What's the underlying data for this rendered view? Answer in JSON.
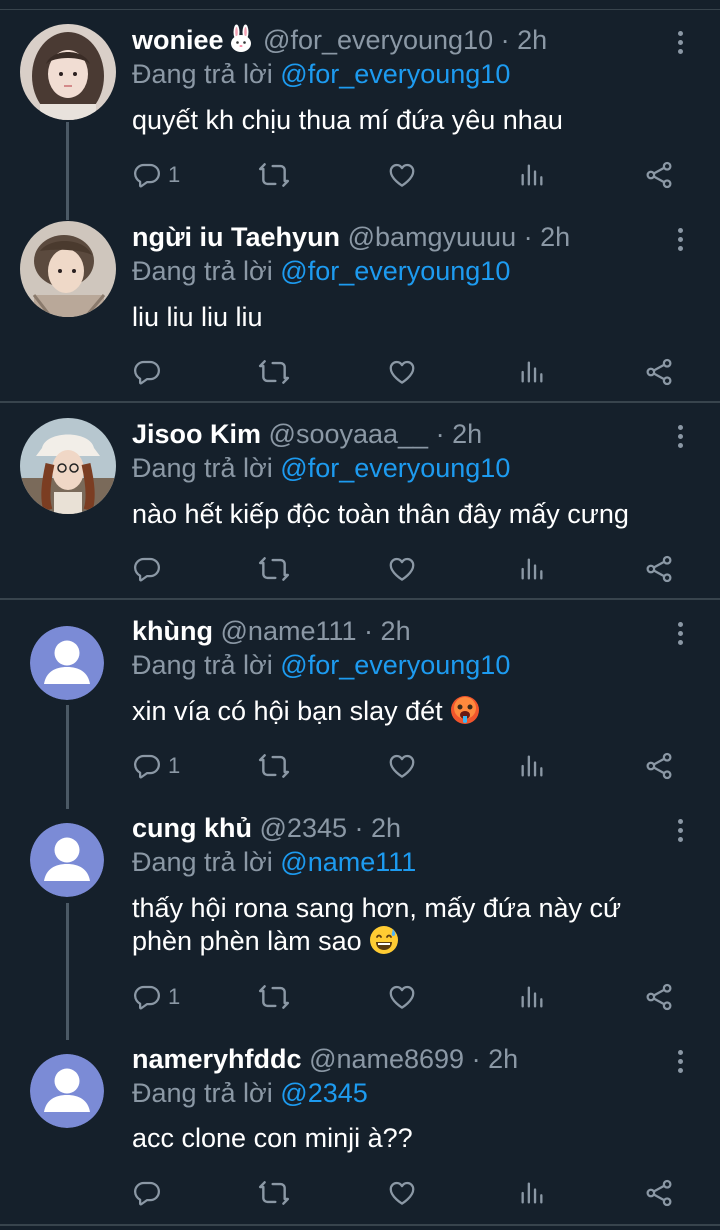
{
  "replying_label": "Đang trả lời",
  "tweets": [
    {
      "name": "woniee",
      "name_emoji": "rabbit-face-emoji",
      "handle": "@for_everyoung10",
      "sep": "·",
      "time": "2h",
      "reply_to": "@for_everyoung10",
      "text": "quyết kh chịu thua mí đứa yêu nhau",
      "reply_count": "1"
    },
    {
      "name": "ngừi iu Taehyun",
      "handle": "@bamgyuuuu",
      "sep": "·",
      "time": "2h",
      "reply_to": "@for_everyoung10",
      "text": "liu liu liu liu",
      "reply_count": ""
    },
    {
      "name": "Jisoo Kim",
      "handle": "@sooyaaa__",
      "sep": "·",
      "time": "2h",
      "reply_to": "@for_everyoung10",
      "text": "nào hết kiếp độc toàn thân đây mấy cưng",
      "reply_count": ""
    },
    {
      "name": "khùng",
      "handle": "@name111",
      "sep": "·",
      "time": "2h",
      "reply_to": "@for_everyoung10",
      "text": "xin vía có hội bạn slay đét",
      "text_emoji": "hot-face-emoji",
      "reply_count": "1"
    },
    {
      "name": "cung khủ",
      "handle": "@2345",
      "sep": "·",
      "time": "2h",
      "reply_to": "@name111",
      "text_line1": "thấy hội rona sang hơn, mấy đứa này cứ",
      "text_line2": "phèn phèn làm sao",
      "text_emoji": "grinning-sweat-emoji",
      "reply_count": "1"
    },
    {
      "name": "nameryhfddc",
      "handle": "@name8699",
      "sep": "·",
      "time": "2h",
      "reply_to": "@2345",
      "text": "acc clone con minji à??",
      "reply_count": ""
    }
  ],
  "colors": {
    "background": "#15202b",
    "divider": "#38444d",
    "secondary": "#8b98a5",
    "accent": "#1d9bf0",
    "default_avatar": "#7b8bd6"
  },
  "icons": [
    "reply-icon",
    "retweet-icon",
    "like-icon",
    "analytics-icon",
    "share-icon",
    "more-icon"
  ]
}
